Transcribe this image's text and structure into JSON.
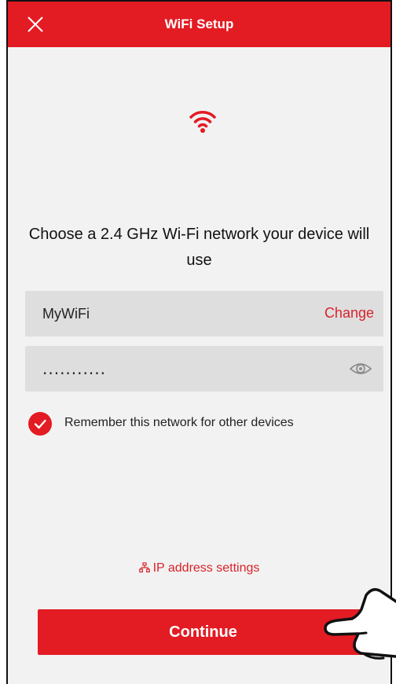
{
  "header": {
    "title": "WiFi Setup",
    "close_icon": "close-icon"
  },
  "status_icon": "wifi-icon",
  "headline": "Choose a 2.4 GHz Wi-Fi network your device will use",
  "network": {
    "name": "MyWiFi",
    "change_label": "Change"
  },
  "password": {
    "value": "...........",
    "toggle_icon": "eye-icon"
  },
  "remember": {
    "checked": true,
    "label": "Remember this network for other devices"
  },
  "ip_settings": {
    "icon": "network-icon",
    "label": "IP address settings"
  },
  "continue_label": "Continue",
  "colors": {
    "accent": "#e31b23",
    "background": "#f2f2f2",
    "field": "#dedede"
  }
}
